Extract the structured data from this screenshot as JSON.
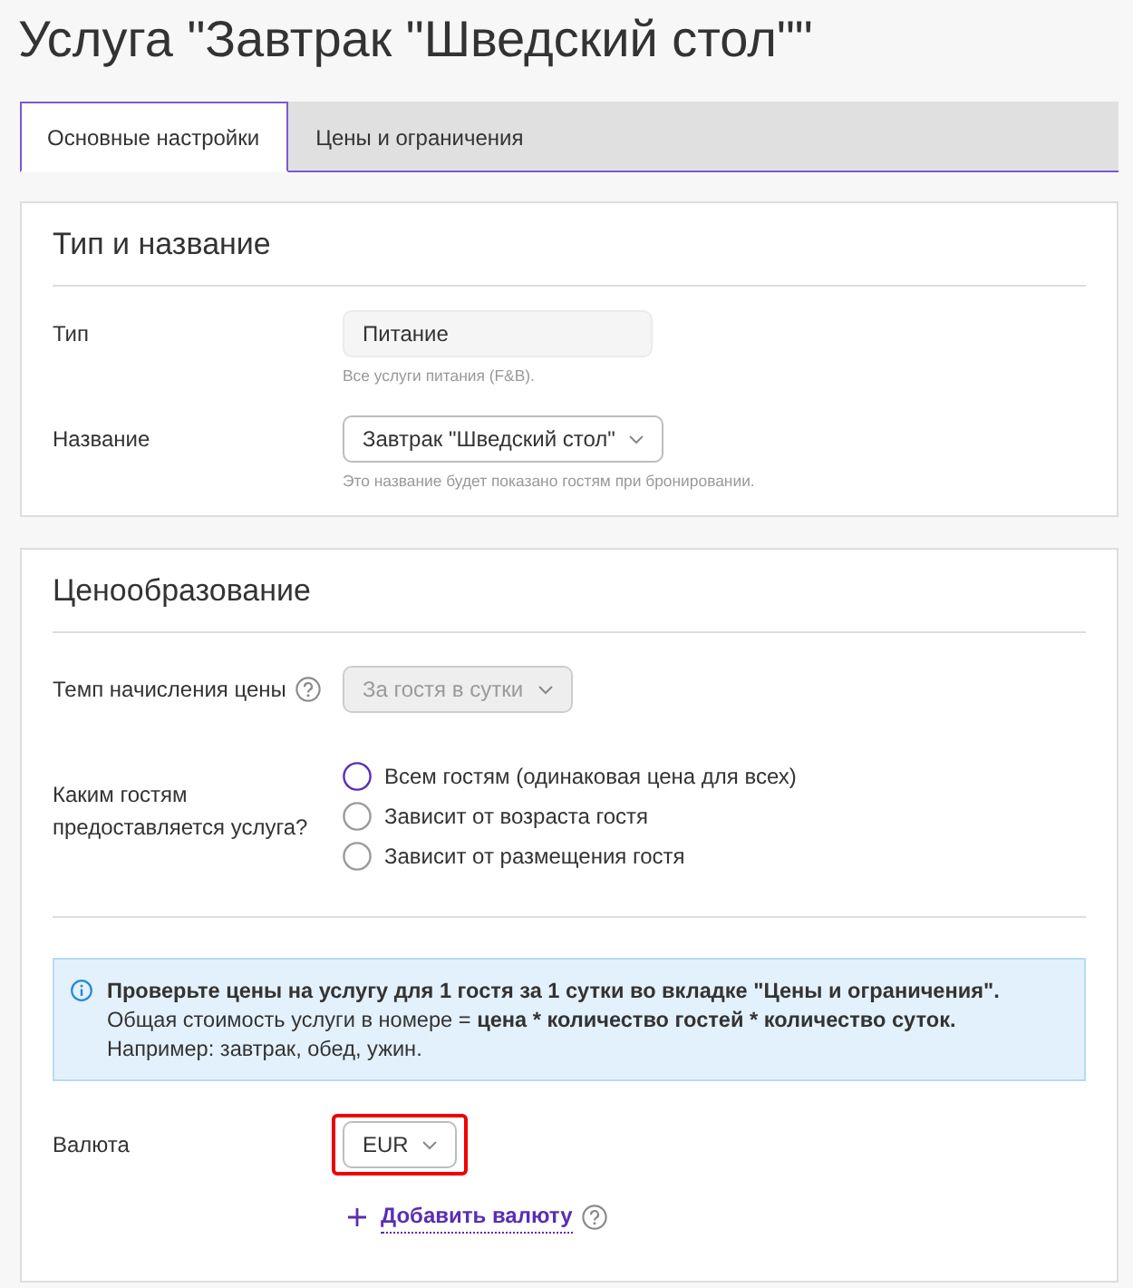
{
  "page_title": "Услуга \"Завтрак \"Шведский стол\"\"",
  "tabs": [
    {
      "label": "Основные настройки",
      "selected": true
    },
    {
      "label": "Цены и ограничения",
      "selected": false
    }
  ],
  "sections": [
    {
      "title": "Тип и название",
      "fields": [
        {
          "kind": "input",
          "label": "Тип",
          "value": "Питание",
          "readonly": true,
          "hint": "Все услуги питания (F&B)."
        },
        {
          "kind": "select",
          "label": "Название",
          "value": "Завтрак \"Шведский стол\"",
          "hint": "Это название будет показано гостям при бронировании."
        }
      ]
    },
    {
      "title": "Ценообразование",
      "fields": [
        {
          "kind": "select",
          "label": "Темп начисления цены",
          "help": true,
          "value": "За гостя в сутки",
          "disabled": true
        },
        {
          "kind": "radio",
          "label": "Каким гостям предоставляется услуга?",
          "options": [
            {
              "label": "Всем гостям (одинаковая цена для всех)",
              "selected": true
            },
            {
              "label": "Зависит от возраста гостя",
              "selected": false
            },
            {
              "label": "Зависит от размещения гостя",
              "selected": false
            }
          ]
        },
        {
          "kind": "divider"
        },
        {
          "kind": "notice",
          "title": "Проверьте цены на услугу для 1 гостя за 1 сутки во вкладке \"Цены и ограничения\".",
          "lines": [
            "Общая стоимость услуги в номере = **цена * количество гостей * количество суток.**",
            "Например: завтрак, обед, ужин."
          ]
        },
        {
          "kind": "select",
          "label": "Валюта",
          "value": "EUR",
          "highlighted": true
        },
        {
          "kind": "link",
          "label": "Добавить валюту",
          "help": true
        }
      ]
    }
  ]
}
